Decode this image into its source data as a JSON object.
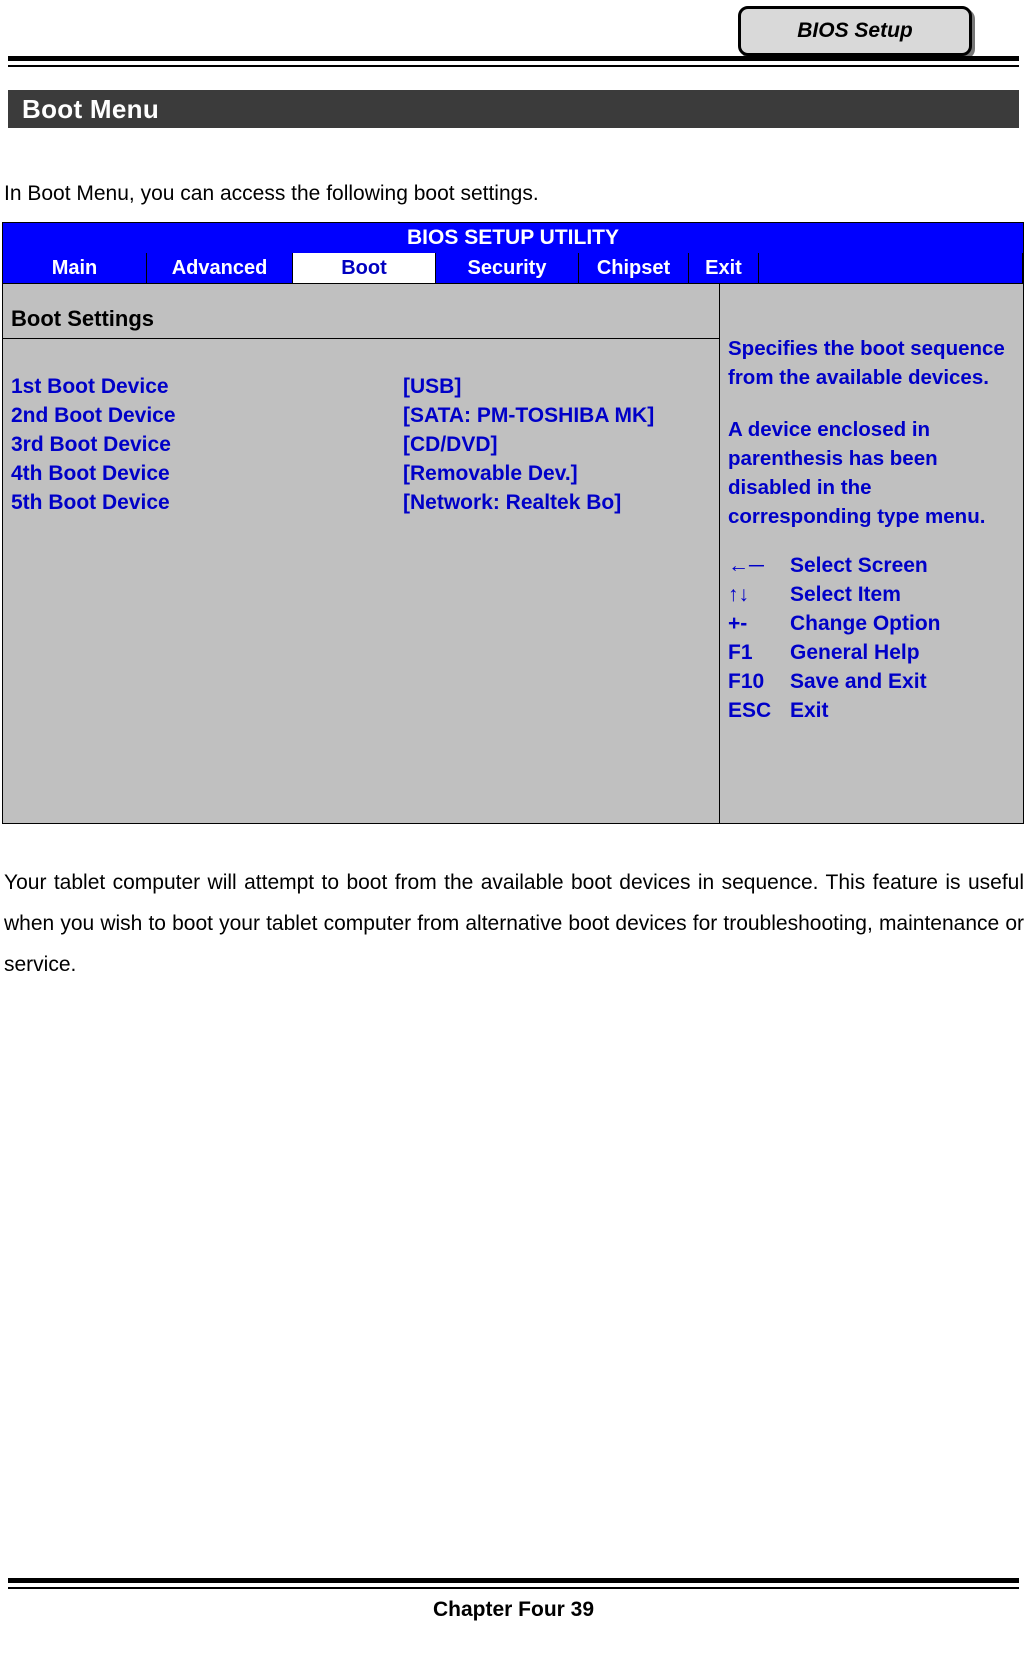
{
  "header": {
    "tab_label": "BIOS Setup"
  },
  "section": {
    "title": "Boot Menu"
  },
  "intro": "In Boot Menu, you can access the following boot settings.",
  "bios": {
    "title": "BIOS SETUP UTILITY",
    "menu": [
      {
        "label": "Main",
        "active": false
      },
      {
        "label": "Advanced",
        "active": false
      },
      {
        "label": "Boot",
        "active": true
      },
      {
        "label": "Security",
        "active": false
      },
      {
        "label": "Chipset",
        "active": false
      },
      {
        "label": "Exit",
        "active": false
      }
    ],
    "settings_heading": "Boot Settings",
    "boot_devices": [
      {
        "label": "1st Boot Device",
        "value": "[USB]"
      },
      {
        "label": "2nd Boot Device",
        "value": "[SATA: PM-TOSHIBA MK]"
      },
      {
        "label": "3rd Boot Device",
        "value": "[CD/DVD]"
      },
      {
        "label": "4th Boot Device",
        "value": "[Removable Dev.]"
      },
      {
        "label": "5th Boot Device",
        "value": "[Network: Realtek Bo]"
      }
    ],
    "help_paragraph_1": "Specifies the boot sequence from the available devices.",
    "help_paragraph_2": "A device enclosed in parenthesis has been disabled in the corresponding type menu.",
    "keys": [
      {
        "key": "←─",
        "desc": "Select Screen"
      },
      {
        "key": "↑↓",
        "desc": "Select Item"
      },
      {
        "key": "+-",
        "desc": "Change Option"
      },
      {
        "key": "F1",
        "desc": "General Help"
      },
      {
        "key": "F10",
        "desc": "Save and Exit"
      },
      {
        "key": "ESC",
        "desc": "Exit"
      }
    ]
  },
  "body_text": "Your tablet computer will attempt to boot from the available boot devices in sequence. This feature is useful when you wish to boot your tablet computer from alternative boot devices for troubleshooting, maintenance or service.",
  "footer": {
    "text": "Chapter Four 39"
  }
}
